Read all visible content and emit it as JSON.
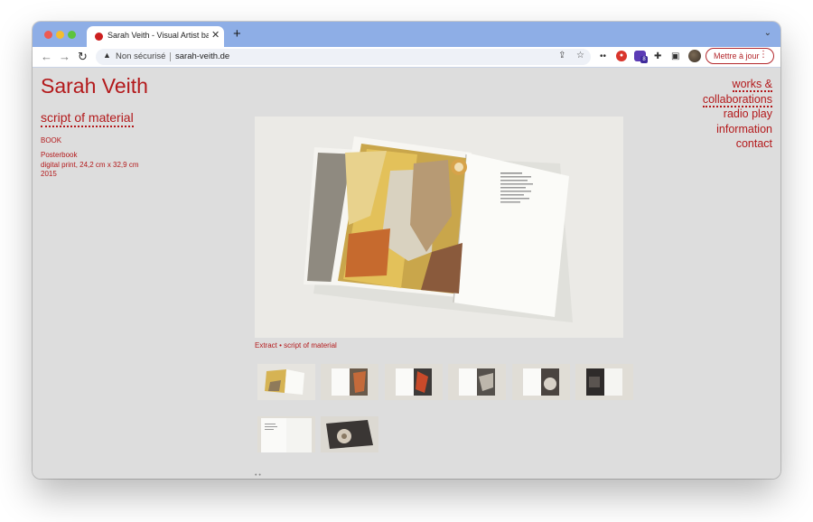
{
  "browser": {
    "tab_title": "Sarah Veith - Visual Artist based",
    "tab_close": "✕",
    "new_tab": "+",
    "security_label": "Non sécurisé",
    "url": "sarah-veith.de",
    "update_label": "Mettre à jour",
    "extension_badge": "8"
  },
  "site": {
    "title": "Sarah Veith",
    "work_title": "script of material",
    "category": "BOOK",
    "description": [
      "Posterbook",
      "digital print, 24,2 cm x 32,9 cm",
      "2015"
    ],
    "nav": [
      {
        "label": "works &"
      },
      {
        "label": "collaborations"
      },
      {
        "label": "radio play"
      },
      {
        "label": "information"
      },
      {
        "label": "contact"
      }
    ],
    "caption": "Extract • script of material",
    "thumbnail_count": 8
  },
  "colors": {
    "accent": "#b3191b",
    "page_bg": "#dddddd",
    "tabbar_bg": "#8eaee6"
  },
  "icons": {
    "back": "arrow-left-icon",
    "forward": "arrow-right-icon",
    "reload": "reload-icon",
    "warning": "warning-triangle-icon",
    "share": "share-icon",
    "bookmark": "star-icon",
    "extensions": "puzzle-icon",
    "sidebar": "sidebar-icon"
  }
}
